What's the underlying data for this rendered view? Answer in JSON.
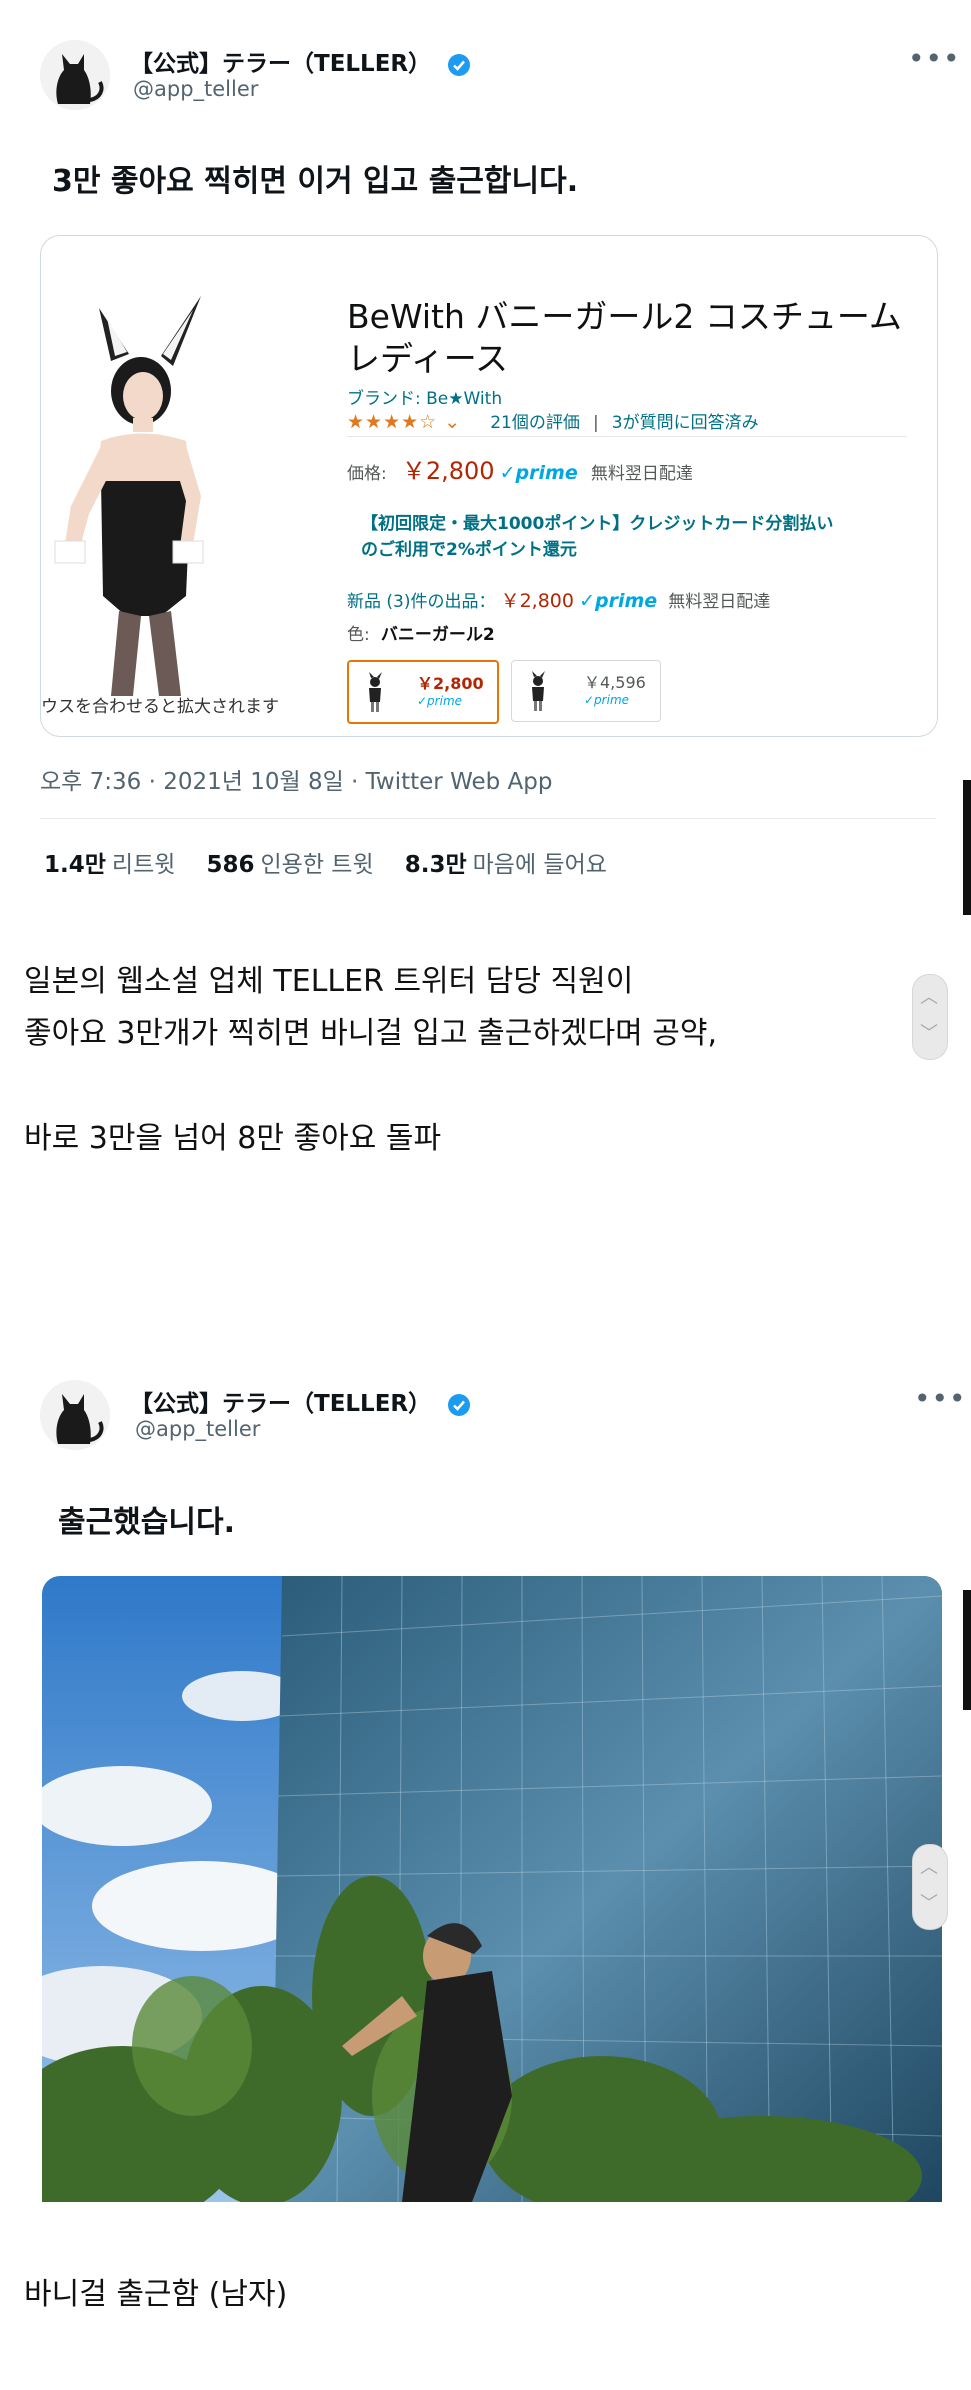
{
  "tweet1": {
    "display_name": "【公式】テラー（TELLER）",
    "handle": "@app_teller",
    "text": "3만 좋아요 찍히면 이거 입고 출근합니다.",
    "more_icon": "more-horizontal-icon",
    "product": {
      "title_line1": "BeWith バニーガール2 コスチューム",
      "title_line2": "レディース",
      "brand": "ブランド: Be★With",
      "stars": "★★★★☆ ⌄",
      "ratings": "21個の評価",
      "sep": "|",
      "answered": "3が質問に回答済み",
      "price_label": "価格:",
      "price": "￥2,800",
      "prime": "✓prime",
      "free_delivery": "無料翌日配達",
      "promo_line1": "【初回限定・最大1000ポイント】クレジットカード分割払い",
      "promo_line2": "のご利用で2%ポイント還元",
      "new_label": "新品 (3)件の出品：",
      "new_price": "￥2,800",
      "new_prime": "✓prime",
      "new_delivery": "無料翌日配達",
      "color_label": "色:",
      "color_value": "バニーガール2",
      "zoom_hint": "ウスを合わせると拡大されます",
      "swatches": [
        {
          "price": "￥2,800",
          "prime": "✓prime"
        },
        {
          "price": "￥4,596",
          "prime": "✓prime"
        }
      ]
    },
    "timestamp": "오후 7:36 · 2021년 10월 8일 · Twitter Web App",
    "stats": [
      {
        "num": "1.4만",
        "label": "리트윗"
      },
      {
        "num": "586",
        "label": "인용한 트윗"
      },
      {
        "num": "8.3만",
        "label": "마음에 들어요"
      }
    ]
  },
  "caption1": {
    "line1": "일본의 웹소설 업체 TELLER 트위터 담당 직원이",
    "line2": "좋아요 3만개가 찍히면 바니걸 입고 출근하겠다며 공약,",
    "line3": "바로 3만을 넘어 8만 좋아요 돌파"
  },
  "tweet2": {
    "display_name": "【公式】テラー（TELLER）",
    "handle": "@app_teller",
    "text": "출근했습니다.",
    "more_icon": "more-horizontal-icon"
  },
  "caption2": {
    "line1": "바니걸 출근함 (남자)"
  },
  "scroll_arrows": {
    "up": "︿",
    "down": "﹀"
  }
}
